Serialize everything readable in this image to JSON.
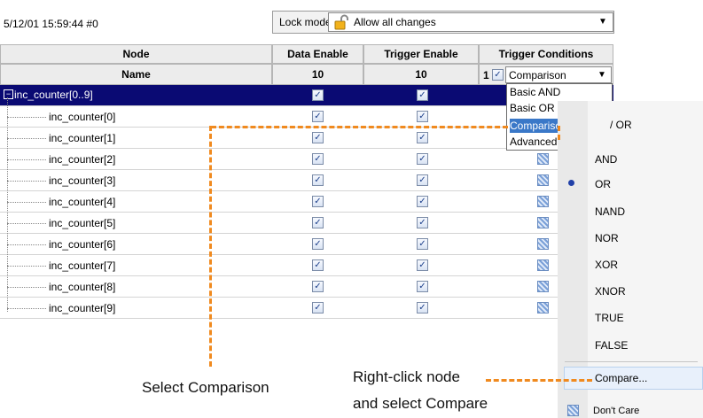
{
  "topbar": {
    "timestamp": "5/12/01 15:59:44  #0",
    "lock_label": "Lock mode:",
    "lock_value": "Allow all changes"
  },
  "table": {
    "headers": [
      "Node",
      "Data Enable",
      "Trigger Enable",
      "Trigger Conditions"
    ],
    "subheaders": {
      "name": "Name",
      "data_enable": "10",
      "trigger_enable": "10",
      "trigger_prefix": "1",
      "trigger_value": "Comparison"
    },
    "group_row": "inc_counter[0..9]",
    "rows": [
      "inc_counter[0]",
      "inc_counter[1]",
      "inc_counter[2]",
      "inc_counter[3]",
      "inc_counter[4]",
      "inc_counter[5]",
      "inc_counter[6]",
      "inc_counter[7]",
      "inc_counter[8]",
      "inc_counter[9]"
    ]
  },
  "dropdown": {
    "options": [
      "Basic AND",
      "Basic OR",
      "Comparison",
      "Advanced"
    ],
    "selected": "Comparison"
  },
  "context_menu": {
    "items": [
      "/ OR",
      "AND",
      "OR",
      "NAND",
      "NOR",
      "XOR",
      "XNOR",
      "TRUE",
      "FALSE",
      "Compare...",
      "Don't Care"
    ],
    "checked": "OR"
  },
  "annotations": {
    "select_comparison": "Select Comparison",
    "right_click_line1": "Right-click node",
    "right_click_line2": "and select Compare"
  },
  "colors": {
    "accent": "#f08a1f",
    "selection": "#0a0a73",
    "highlight": "#3a78c8"
  }
}
